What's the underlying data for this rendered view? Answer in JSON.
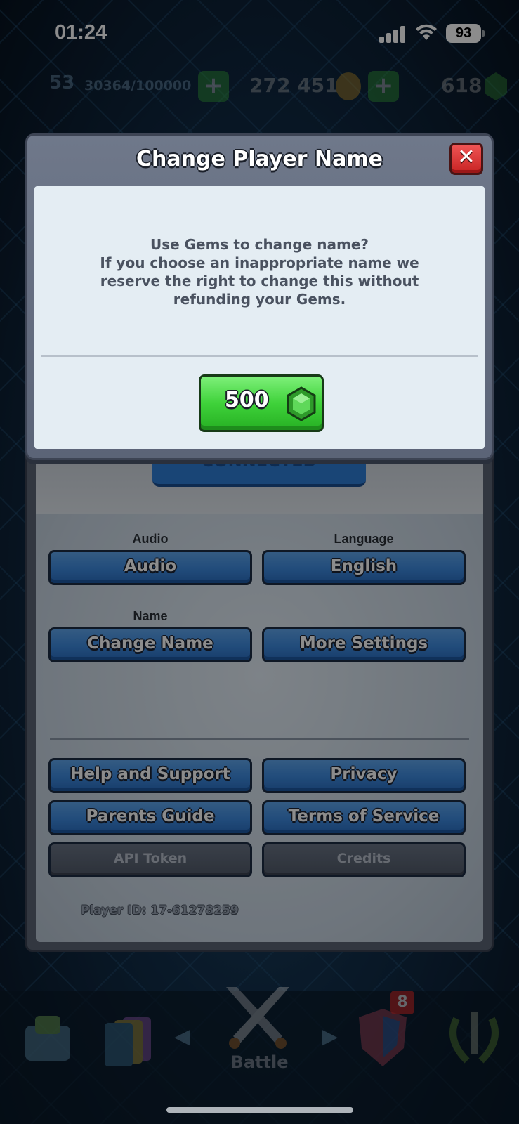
{
  "status_bar": {
    "time": "01:24",
    "battery": "93"
  },
  "resources": {
    "level": "53",
    "xp": "30364/100000",
    "gold": "272 451",
    "gems": "618"
  },
  "modal": {
    "title": "Change Player Name",
    "message_lines": [
      "Use Gems to change name?",
      "If you choose an inappropriate name we",
      "reserve the right to change this without",
      "refunding your Gems."
    ],
    "price": "500",
    "close_label": "✕"
  },
  "settings": {
    "connected_label": "CONNECTED",
    "audio_label": "Audio",
    "audio_button": "Audio",
    "language_label": "Language",
    "language_button": "English",
    "name_label": "Name",
    "change_name_button": "Change Name",
    "more_settings_button": "More Settings",
    "help_button": "Help and Support",
    "privacy_button": "Privacy",
    "parents_button": "Parents Guide",
    "terms_button": "Terms of Service",
    "api_button": "API Token",
    "credits_button": "Credits",
    "player_id": "Player ID: 17-61278259"
  },
  "bottom_nav": {
    "battle_label": "Battle",
    "badge": "8"
  },
  "colors": {
    "primary_blue": "#3d8ae0",
    "close_red": "#e03a3a",
    "gem_green": "#3fd23a",
    "panel_grey": "#5b6576"
  }
}
